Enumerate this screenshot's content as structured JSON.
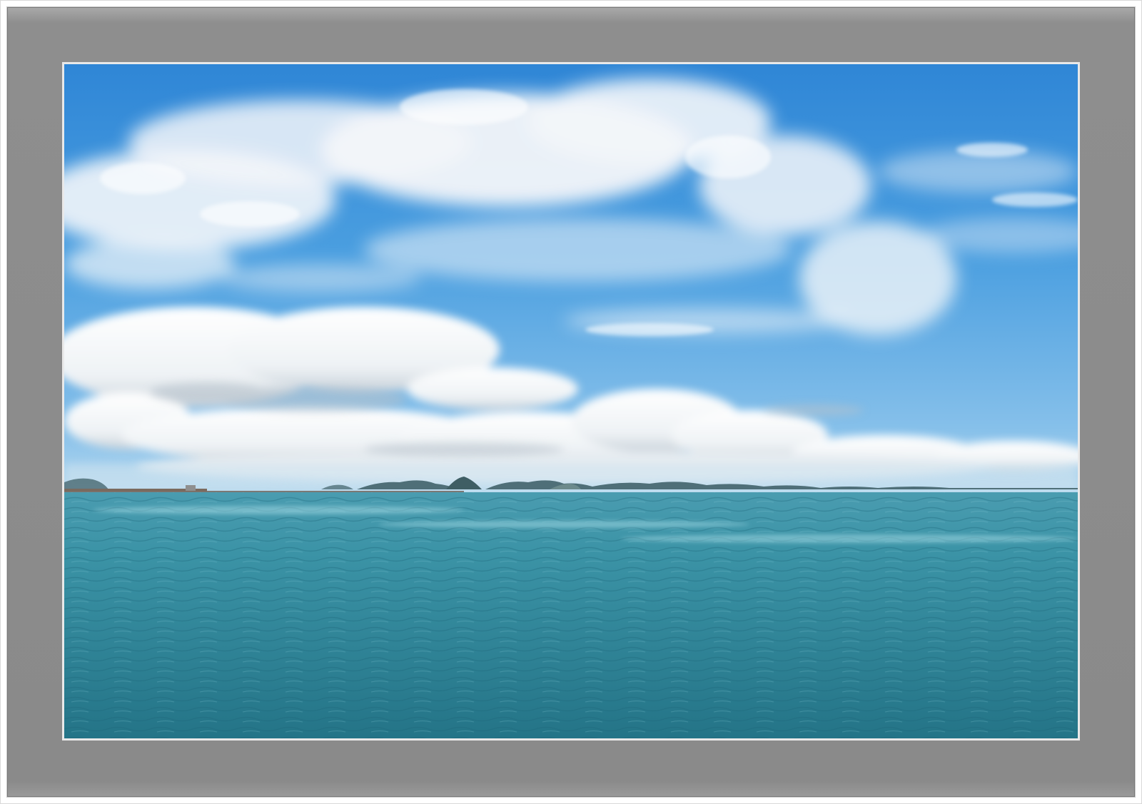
{
  "scene": {
    "subject": "seascape-with-clouds-and-distant-islands",
    "colors": {
      "frame_mat": "#8e8e8e",
      "photo_edge": "#e9e9e9",
      "sky_top": "#2f86d6",
      "sky_horizon": "#a9d2ee",
      "cloud": "#f4f6f8",
      "cloud_shadow": "#c9d2da",
      "islands": "#4e6f75",
      "sea_near": "#2b7f8e",
      "sea_far": "#4a9cb0"
    }
  }
}
